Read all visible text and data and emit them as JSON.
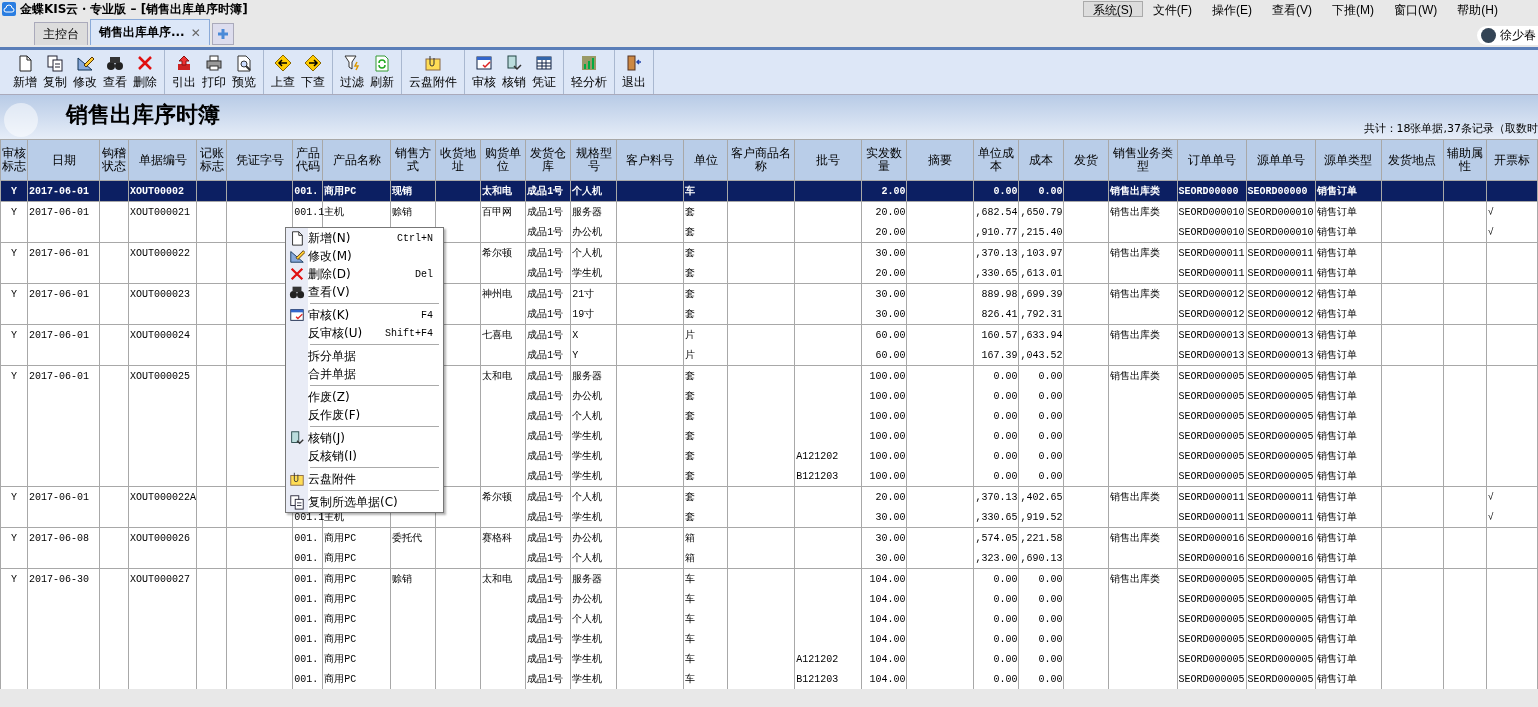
{
  "window": {
    "title": "金蝶KIS云・专业版 – [销售出库单序时簿]"
  },
  "menu": [
    {
      "label": "系统(S)",
      "selected": true
    },
    {
      "label": "文件(F)",
      "selected": false
    },
    {
      "label": "操作(E)",
      "selected": false
    },
    {
      "label": "查看(V)",
      "selected": false
    },
    {
      "label": "下推(M)",
      "selected": false
    },
    {
      "label": "窗口(W)",
      "selected": false
    },
    {
      "label": "帮助(H)",
      "selected": false
    }
  ],
  "tabs": [
    {
      "label": "主控台",
      "selected": false
    },
    {
      "label": "销售出库单序...",
      "selected": true,
      "close": "✕"
    }
  ],
  "user": {
    "name": "徐少春"
  },
  "toolbar": [
    [
      {
        "label": "新增",
        "kind": "new"
      },
      {
        "label": "复制",
        "kind": "copy"
      },
      {
        "label": "修改",
        "kind": "edit"
      },
      {
        "label": "查看",
        "kind": "view"
      },
      {
        "label": "删除",
        "kind": "delete"
      }
    ],
    [
      {
        "label": "引出",
        "kind": "export"
      },
      {
        "label": "打印",
        "kind": "print"
      },
      {
        "label": "预览",
        "kind": "preview"
      }
    ],
    [
      {
        "label": "上查",
        "kind": "up"
      },
      {
        "label": "下查",
        "kind": "down"
      }
    ],
    [
      {
        "label": "过滤",
        "kind": "filter"
      },
      {
        "label": "刷新",
        "kind": "refresh"
      }
    ],
    [
      {
        "label": "云盘附件",
        "kind": "attach"
      }
    ],
    [
      {
        "label": "审核",
        "kind": "audit"
      },
      {
        "label": "核销",
        "kind": "verify"
      },
      {
        "label": "凭证",
        "kind": "voucher"
      }
    ],
    [
      {
        "label": "轻分析",
        "kind": "chart"
      }
    ],
    [
      {
        "label": "退出",
        "kind": "exit"
      }
    ]
  ],
  "page": {
    "title": "销售出库序时簿",
    "summary": "共计：18张单据,37条记录（取数时"
  },
  "table": {
    "columns": [
      "审核标志",
      "日期",
      "钩稽状态",
      "单据编号",
      "记账标志",
      "凭证字号",
      "产品代码",
      "产品名称",
      "销售方式",
      "收货地址",
      "购货单位",
      "发货仓库",
      "规格型号",
      "客户料号",
      "单位",
      "客户商品名称",
      "批号",
      "实发数量",
      "摘要",
      "单位成本",
      "成本",
      "发货",
      "销售业务类型",
      "订单单号",
      "源单单号",
      "源单类型",
      "发货地点",
      "辅助属性",
      "开票标"
    ],
    "rows": [
      {
        "selected": true,
        "cells": [
          "Y",
          "2017-06-01",
          "",
          "XOUT00002",
          "",
          "",
          "001.",
          "商用PC",
          "现销",
          "",
          "太和电",
          "成品1号",
          "个人机",
          "",
          "车",
          "",
          "",
          "2.00",
          "",
          "0.00",
          "0.00",
          "",
          "销售出库类",
          "SEORD00000",
          "SEORD00000",
          "销售订单",
          "",
          "",
          ""
        ]
      },
      {
        "selected": false,
        "cells": [
          "Y",
          "2017-06-01",
          "",
          "XOUT000021",
          "",
          "",
          "001.1",
          "主机",
          "赊销",
          "",
          "百甲网",
          "成品1号",
          "服务器",
          "",
          "套",
          "",
          "",
          "20.00",
          "",
          ",682.54",
          ",650.79",
          "",
          "销售出库类",
          "SEORD000010",
          "SEORD000010",
          "销售订单",
          "",
          "",
          "√"
        ]
      },
      {
        "selected": false,
        "cells": [
          "",
          "",
          "",
          "",
          "",
          "",
          "",
          "",
          "",
          "",
          "",
          "成品1号",
          "办公机",
          "",
          "套",
          "",
          "",
          "20.00",
          "",
          ",910.77",
          ",215.40",
          "",
          "",
          "SEORD000010",
          "SEORD000010",
          "销售订单",
          "",
          "",
          "√"
        ]
      },
      {
        "selected": false,
        "cells": [
          "Y",
          "2017-06-01",
          "",
          "XOUT000022",
          "",
          "",
          "",
          "",
          "",
          "",
          "希尔顿",
          "成品1号",
          "个人机",
          "",
          "套",
          "",
          "",
          "30.00",
          "",
          ",370.13",
          ",103.97",
          "",
          "销售出库类",
          "SEORD000011",
          "SEORD000011",
          "销售订单",
          "",
          "",
          ""
        ]
      },
      {
        "selected": false,
        "cells": [
          "",
          "",
          "",
          "",
          "",
          "",
          "",
          "",
          "",
          "",
          "",
          "成品1号",
          "学生机",
          "",
          "套",
          "",
          "",
          "20.00",
          "",
          ",330.65",
          ",613.01",
          "",
          "",
          "SEORD000011",
          "SEORD000011",
          "销售订单",
          "",
          "",
          ""
        ]
      },
      {
        "selected": false,
        "cells": [
          "Y",
          "2017-06-01",
          "",
          "XOUT000023",
          "",
          "",
          "",
          "",
          "",
          "",
          "神州电",
          "成品1号",
          "21寸",
          "",
          "套",
          "",
          "",
          "30.00",
          "",
          "889.98",
          ",699.39",
          "",
          "销售出库类",
          "SEORD000012",
          "SEORD000012",
          "销售订单",
          "",
          "",
          ""
        ]
      },
      {
        "selected": false,
        "cells": [
          "",
          "",
          "",
          "",
          "",
          "",
          "",
          "",
          "",
          "",
          "",
          "成品1号",
          "19寸",
          "",
          "套",
          "",
          "",
          "30.00",
          "",
          "826.41",
          ",792.31",
          "",
          "",
          "SEORD000012",
          "SEORD000012",
          "销售订单",
          "",
          "",
          ""
        ]
      },
      {
        "selected": false,
        "cells": [
          "Y",
          "2017-06-01",
          "",
          "XOUT000024",
          "",
          "",
          "",
          "",
          "",
          "",
          "七喜电",
          "成品1号",
          "X",
          "",
          "片",
          "",
          "",
          "60.00",
          "",
          "160.57",
          ",633.94",
          "",
          "销售出库类",
          "SEORD000013",
          "SEORD000013",
          "销售订单",
          "",
          "",
          ""
        ]
      },
      {
        "selected": false,
        "cells": [
          "",
          "",
          "",
          "",
          "",
          "",
          "",
          "",
          "",
          "",
          "",
          "成品1号",
          "Y",
          "",
          "片",
          "",
          "",
          "60.00",
          "",
          "167.39",
          ",043.52",
          "",
          "",
          "SEORD000013",
          "SEORD000013",
          "销售订单",
          "",
          "",
          ""
        ]
      },
      {
        "selected": false,
        "cells": [
          "Y",
          "2017-06-01",
          "",
          "XOUT000025",
          "",
          "",
          "",
          "",
          "",
          "",
          "太和电",
          "成品1号",
          "服务器",
          "",
          "套",
          "",
          "",
          "100.00",
          "",
          "0.00",
          "0.00",
          "",
          "销售出库类",
          "SEORD000005",
          "SEORD000005",
          "销售订单",
          "",
          "",
          ""
        ]
      },
      {
        "selected": false,
        "cells": [
          "",
          "",
          "",
          "",
          "",
          "",
          "",
          "",
          "",
          "",
          "",
          "成品1号",
          "办公机",
          "",
          "套",
          "",
          "",
          "100.00",
          "",
          "0.00",
          "0.00",
          "",
          "",
          "SEORD000005",
          "SEORD000005",
          "销售订单",
          "",
          "",
          ""
        ]
      },
      {
        "selected": false,
        "cells": [
          "",
          "",
          "",
          "",
          "",
          "",
          "",
          "",
          "",
          "",
          "",
          "成品1号",
          "个人机",
          "",
          "套",
          "",
          "",
          "100.00",
          "",
          "0.00",
          "0.00",
          "",
          "",
          "SEORD000005",
          "SEORD000005",
          "销售订单",
          "",
          "",
          ""
        ]
      },
      {
        "selected": false,
        "cells": [
          "",
          "",
          "",
          "",
          "",
          "",
          "",
          "",
          "",
          "",
          "",
          "成品1号",
          "学生机",
          "",
          "套",
          "",
          "",
          "100.00",
          "",
          "0.00",
          "0.00",
          "",
          "",
          "SEORD000005",
          "SEORD000005",
          "销售订单",
          "",
          "",
          ""
        ]
      },
      {
        "selected": false,
        "cells": [
          "",
          "",
          "",
          "",
          "",
          "",
          "",
          "",
          "",
          "",
          "",
          "成品1号",
          "学生机",
          "",
          "套",
          "",
          "A121202",
          "100.00",
          "",
          "0.00",
          "0.00",
          "",
          "",
          "SEORD000005",
          "SEORD000005",
          "销售订单",
          "",
          "",
          ""
        ]
      },
      {
        "selected": false,
        "cells": [
          "",
          "",
          "",
          "",
          "",
          "",
          "",
          "",
          "",
          "",
          "",
          "成品1号",
          "学生机",
          "",
          "套",
          "",
          "B121203",
          "100.00",
          "",
          "0.00",
          "0.00",
          "",
          "",
          "SEORD000005",
          "SEORD000005",
          "销售订单",
          "",
          "",
          ""
        ]
      },
      {
        "selected": false,
        "cells": [
          "Y",
          "2017-06-01",
          "",
          "XOUT000022A",
          "",
          "",
          "",
          "",
          "",
          "",
          "希尔顿",
          "成品1号",
          "个人机",
          "",
          "套",
          "",
          "",
          "20.00",
          "",
          ",370.13",
          ",402.65",
          "",
          "销售出库类",
          "SEORD000011",
          "SEORD000011",
          "销售订单",
          "",
          "",
          "√"
        ]
      },
      {
        "selected": false,
        "cells": [
          "",
          "",
          "",
          "",
          "",
          "",
          "001.1",
          "主机",
          "",
          "",
          "",
          "成品1号",
          "学生机",
          "",
          "套",
          "",
          "",
          "30.00",
          "",
          ",330.65",
          ",919.52",
          "",
          "",
          "SEORD000011",
          "SEORD000011",
          "销售订单",
          "",
          "",
          "√"
        ]
      },
      {
        "selected": false,
        "cells": [
          "Y",
          "2017-06-08",
          "",
          "XOUT000026",
          "",
          "",
          "001.",
          "商用PC",
          "委托代",
          "",
          "赛格科",
          "成品1号",
          "办公机",
          "",
          "箱",
          "",
          "",
          "30.00",
          "",
          ",574.05",
          ",221.58",
          "",
          "销售出库类",
          "SEORD000016",
          "SEORD000016",
          "销售订单",
          "",
          "",
          ""
        ]
      },
      {
        "selected": false,
        "cells": [
          "",
          "",
          "",
          "",
          "",
          "",
          "001.",
          "商用PC",
          "",
          "",
          "",
          "成品1号",
          "个人机",
          "",
          "箱",
          "",
          "",
          "30.00",
          "",
          ",323.00",
          ",690.13",
          "",
          "",
          "SEORD000016",
          "SEORD000016",
          "销售订单",
          "",
          "",
          ""
        ]
      },
      {
        "selected": false,
        "cells": [
          "Y",
          "2017-06-30",
          "",
          "XOUT000027",
          "",
          "",
          "001.",
          "商用PC",
          "赊销",
          "",
          "太和电",
          "成品1号",
          "服务器",
          "",
          "车",
          "",
          "",
          "104.00",
          "",
          "0.00",
          "0.00",
          "",
          "销售出库类",
          "SEORD000005",
          "SEORD000005",
          "销售订单",
          "",
          "",
          ""
        ]
      },
      {
        "selected": false,
        "cells": [
          "",
          "",
          "",
          "",
          "",
          "",
          "001.",
          "商用PC",
          "",
          "",
          "",
          "成品1号",
          "办公机",
          "",
          "车",
          "",
          "",
          "104.00",
          "",
          "0.00",
          "0.00",
          "",
          "",
          "SEORD000005",
          "SEORD000005",
          "销售订单",
          "",
          "",
          ""
        ]
      },
      {
        "selected": false,
        "cells": [
          "",
          "",
          "",
          "",
          "",
          "",
          "001.",
          "商用PC",
          "",
          "",
          "",
          "成品1号",
          "个人机",
          "",
          "车",
          "",
          "",
          "104.00",
          "",
          "0.00",
          "0.00",
          "",
          "",
          "SEORD000005",
          "SEORD000005",
          "销售订单",
          "",
          "",
          ""
        ]
      },
      {
        "selected": false,
        "cells": [
          "",
          "",
          "",
          "",
          "",
          "",
          "001.",
          "商用PC",
          "",
          "",
          "",
          "成品1号",
          "学生机",
          "",
          "车",
          "",
          "",
          "104.00",
          "",
          "0.00",
          "0.00",
          "",
          "",
          "SEORD000005",
          "SEORD000005",
          "销售订单",
          "",
          "",
          ""
        ]
      },
      {
        "selected": false,
        "cells": [
          "",
          "",
          "",
          "",
          "",
          "",
          "001.",
          "商用PC",
          "",
          "",
          "",
          "成品1号",
          "学生机",
          "",
          "车",
          "",
          "A121202",
          "104.00",
          "",
          "0.00",
          "0.00",
          "",
          "",
          "SEORD000005",
          "SEORD000005",
          "销售订单",
          "",
          "",
          ""
        ]
      },
      {
        "selected": false,
        "cells": [
          "",
          "",
          "",
          "",
          "",
          "",
          "001.",
          "商用PC",
          "",
          "",
          "",
          "成品1号",
          "学生机",
          "",
          "车",
          "",
          "B121203",
          "104.00",
          "",
          "0.00",
          "0.00",
          "",
          "",
          "SEORD000005",
          "SEORD000005",
          "销售订单",
          "",
          "",
          ""
        ]
      }
    ]
  },
  "context_menu": [
    {
      "kind": "new",
      "label": "新增(N)",
      "shortcut": "Ctrl+N"
    },
    {
      "kind": "edit",
      "label": "修改(M)"
    },
    {
      "kind": "delete",
      "label": "删除(D)",
      "shortcut": "Del"
    },
    {
      "kind": "view",
      "label": "查看(V)"
    },
    {
      "kind": "separator"
    },
    {
      "kind": "audit",
      "label": "审核(K)",
      "shortcut": "F4"
    },
    {
      "kind": "plain",
      "label": "反审核(U)",
      "shortcut": "Shift+F4"
    },
    {
      "kind": "separator"
    },
    {
      "kind": "plain",
      "label": "拆分单据"
    },
    {
      "kind": "plain",
      "label": "合并单据"
    },
    {
      "kind": "separator"
    },
    {
      "kind": "plain",
      "label": "作废(Z)"
    },
    {
      "kind": "plain",
      "label": "反作废(F)"
    },
    {
      "kind": "separator"
    },
    {
      "kind": "verify",
      "label": "核销(J)"
    },
    {
      "kind": "plain",
      "label": "反核销(I)"
    },
    {
      "kind": "separator"
    },
    {
      "kind": "attach",
      "label": "云盘附件"
    },
    {
      "kind": "separator"
    },
    {
      "kind": "copy",
      "label": "复制所选单据(C)"
    }
  ]
}
